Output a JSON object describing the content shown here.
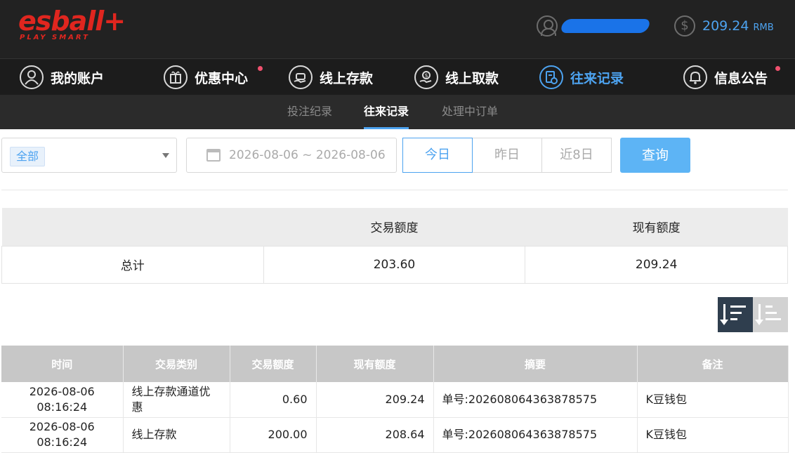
{
  "header": {
    "logo_text": "esball+",
    "logo_tagline": "PLAY SMART",
    "balance_amount": "209.24",
    "balance_unit": "RMB"
  },
  "mainnav": [
    {
      "label": "我的账户",
      "icon": "user-circle-icon"
    },
    {
      "label": "优惠中心",
      "icon": "gift-icon"
    },
    {
      "label": "线上存款",
      "icon": "deposit-icon"
    },
    {
      "label": "线上取款",
      "icon": "withdraw-icon"
    },
    {
      "label": "往来记录",
      "icon": "records-icon"
    },
    {
      "label": "信息公告",
      "icon": "bell-icon"
    }
  ],
  "subnav": [
    "投注纪录",
    "往来记录",
    "处理中订单"
  ],
  "filter": {
    "type_selected": "全部",
    "date_range": "2026-08-06 ~ 2026-08-06",
    "quick": [
      "今日",
      "昨日",
      "近8日"
    ],
    "query_label": "查询"
  },
  "summary": {
    "headers": [
      "",
      "交易额度",
      "现有额度"
    ],
    "row_label": "总计",
    "total_amount": "203.60",
    "current_balance": "209.24"
  },
  "records": {
    "headers": [
      "时间",
      "交易类别",
      "交易额度",
      "现有额度",
      "摘要",
      "备注"
    ],
    "rows": [
      [
        "2026-08-06 08:16:24",
        "线上存款通道优惠",
        "0.60",
        "209.24",
        "单号:202608064363878575",
        "K豆钱包"
      ],
      [
        "2026-08-06 08:16:24",
        "线上存款",
        "200.00",
        "208.64",
        "单号:202608064363878575",
        "K豆钱包"
      ]
    ]
  },
  "colors": {
    "accent": "#4da3f0",
    "brand": "#e0261f",
    "header_bg": "#222222",
    "notify_dot": "#f0506e"
  }
}
